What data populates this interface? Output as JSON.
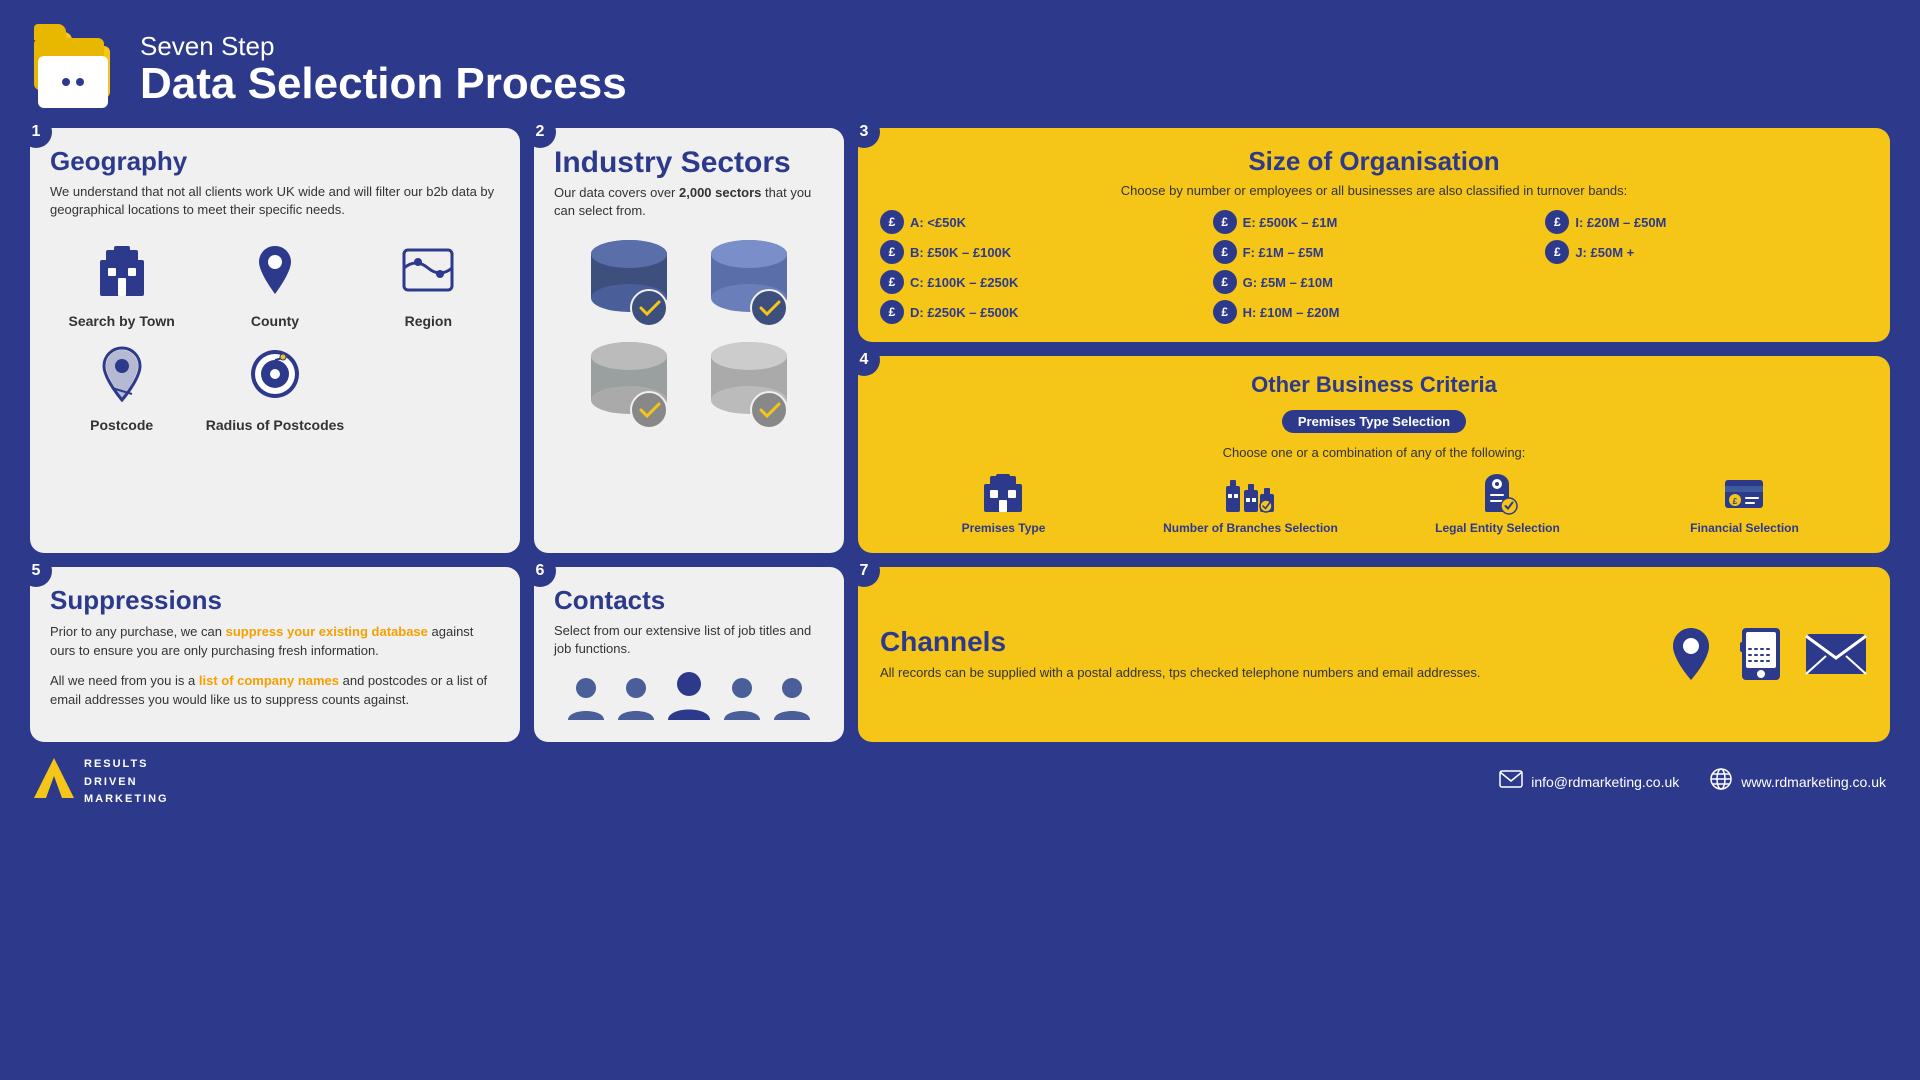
{
  "header": {
    "subtitle": "Seven Step",
    "title": "Data Selection Process",
    "icon_alt": "folder-icon"
  },
  "steps": {
    "geography": {
      "step": "1",
      "title": "Geography",
      "body": "We understand that not all clients work UK wide and will filter our b2b data by geographical locations to meet their specific needs.",
      "items": [
        {
          "label": "Search by Town",
          "icon": "building-icon"
        },
        {
          "label": "County",
          "icon": "map-pin-icon"
        },
        {
          "label": "Region",
          "icon": "region-icon"
        },
        {
          "label": "Postcode",
          "icon": "postcode-icon"
        },
        {
          "label": "Radius of Postcodes",
          "icon": "radius-icon"
        }
      ]
    },
    "industry": {
      "step": "2",
      "title": "Industry Sectors",
      "body_pre": "Our data covers over ",
      "body_highlight": "2,000 sectors",
      "body_post": " that you can select from.",
      "icon": "database-icon"
    },
    "size": {
      "step": "3",
      "title": "Size of Organisation",
      "subtitle": "Choose by number or employees or all businesses are also classified in turnover bands:",
      "bands": [
        {
          "label": "A: <£50K"
        },
        {
          "label": "E: £500K – £1M"
        },
        {
          "label": "I: £20M – £50M"
        },
        {
          "label": "B: £50K – £100K"
        },
        {
          "label": "F: £1M – £5M"
        },
        {
          "label": "J: £50M +"
        },
        {
          "label": "C: £100K – £250K"
        },
        {
          "label": "G: £5M – £10M"
        },
        {
          "label": ""
        },
        {
          "label": "D: £250K – £500K"
        },
        {
          "label": "H: £10M – £20M"
        },
        {
          "label": ""
        }
      ]
    },
    "other": {
      "step": "4",
      "title": "Other Business Criteria",
      "badge": "Premises Type Selection",
      "subtitle": "Choose one or a combination of any of the following:",
      "items": [
        {
          "label": "Premises Type",
          "icon": "premises-icon"
        },
        {
          "label": "Number of Branches Selection",
          "icon": "branches-icon"
        },
        {
          "label": "Legal Entity Selection",
          "icon": "legal-icon"
        },
        {
          "label": "Financial Selection",
          "icon": "financial-icon"
        }
      ]
    },
    "suppressions": {
      "step": "5",
      "title": "Suppressions",
      "body1": "Prior to any purchase, we can ",
      "body1_link": "suppress your existing database",
      "body1_end": " against ours to ensure you are only purchasing fresh information.",
      "body2_pre": "All we need from you is a ",
      "body2_link": "list of company names",
      "body2_end": " and postcodes or a list of email addresses you would like us to suppress counts against."
    },
    "contacts": {
      "step": "6",
      "title": "Contacts",
      "body": "Select from our extensive list of job titles and job functions.",
      "icon": "people-icon"
    },
    "channels": {
      "step": "7",
      "title": "Channels",
      "body": "All records can be supplied with a postal address, tps checked telephone numbers and email addresses.",
      "icons": [
        "location-icon",
        "phone-icon",
        "email-icon"
      ]
    }
  },
  "footer": {
    "logo_lines": [
      "RESULTS",
      "DRIVEN",
      "MARKETING"
    ],
    "email_icon": "email-icon",
    "email": "info@rdmarketing.co.uk",
    "globe_icon": "globe-icon",
    "website": "www.rdmarketing.co.uk"
  }
}
